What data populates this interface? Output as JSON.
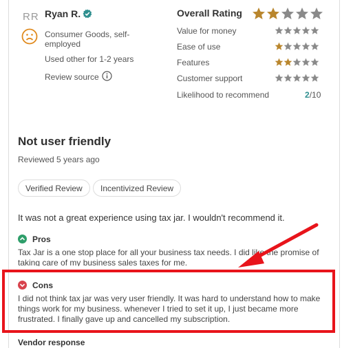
{
  "reviewer": {
    "initials": "RR",
    "name": "Ryan R.",
    "industry": "Consumer Goods, self-employed",
    "usage": "Used other for 1-2 years",
    "source_label": "Review source"
  },
  "ratings": {
    "overall_label": "Overall Rating",
    "overall_stars": 2,
    "items": [
      {
        "label": "Value for money",
        "stars": 0
      },
      {
        "label": "Ease of use",
        "stars": 1
      },
      {
        "label": "Features",
        "stars": 2
      },
      {
        "label": "Customer support",
        "stars": 0
      }
    ],
    "likelihood_label": "Likelihood to recommend",
    "likelihood_value": "2",
    "likelihood_max": "/10"
  },
  "review": {
    "title": "Not user friendly",
    "reviewed": "Reviewed 5 years ago",
    "tags": [
      "Verified Review",
      "Incentivized Review"
    ],
    "summary": "It was not a great experience using tax jar. I wouldn't recommend it.",
    "pros_title": "Pros",
    "pros_text": "Tax Jar is a one stop place for all your business tax needs. I did like the promise of taking care of my business sales taxes for me.",
    "cons_title": "Cons",
    "cons_text": "I did not think tax jar was very user friendly. It was hard to understand how to make things work for my business. whenever I tried to set it up, I just became more frustrated. I finally gave up and cancelled my subscription.",
    "vendor_response": "Vendor response"
  },
  "colors": {
    "star_filled": "#b9862d",
    "star_empty": "#8a8a8a",
    "verified": "#2f8f8f",
    "highlight": "#e8141b"
  }
}
